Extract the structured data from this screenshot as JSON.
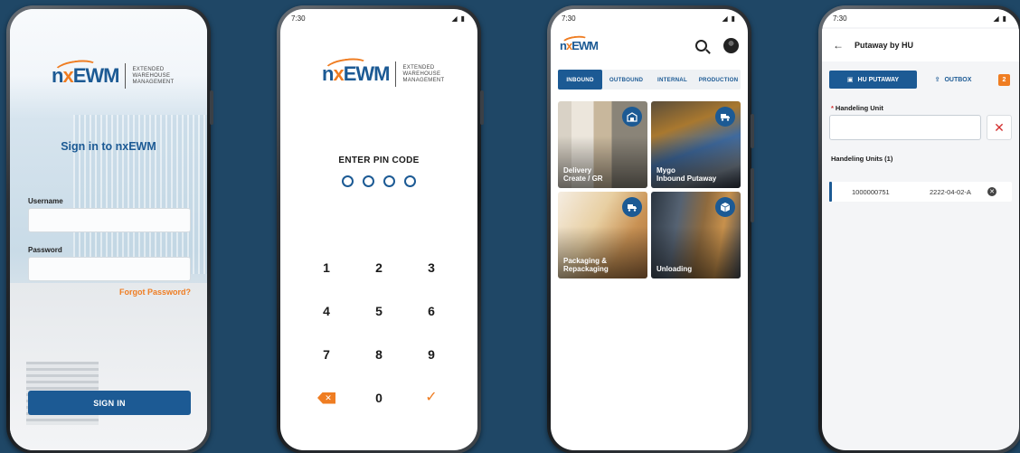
{
  "colors": {
    "background": "#1f4766",
    "primary": "#1c5a94",
    "accent": "#ef7d22",
    "danger": "#d32f2f"
  },
  "logo": {
    "brand": "nxEWM",
    "brand_prefix": "n",
    "brand_x": "x",
    "brand_suffix": "EWM",
    "line1": "EXTENDED",
    "line2": "WAREHOUSE",
    "line3": "MANAGEMENT"
  },
  "login": {
    "title": "Sign in to nxEWM",
    "username_label": "Username",
    "password_label": "Password",
    "forgot_label": "Forgot Password?",
    "signin_label": "SIGN IN"
  },
  "pin": {
    "time": "7:30",
    "title": "ENTER PIN CODE",
    "keys": [
      "1",
      "2",
      "3",
      "4",
      "5",
      "6",
      "7",
      "8",
      "9"
    ],
    "zero": "0",
    "delete_icon": "backspace-icon",
    "confirm_icon": "check-icon"
  },
  "home": {
    "time": "7:30",
    "tabs": [
      "INBOUND",
      "OUTBOUND",
      "INTERNAL",
      "PRODUCTION"
    ],
    "tiles": [
      {
        "label": "Delivery\nCreate / GR",
        "icon": "warehouse-icon"
      },
      {
        "label": "Mygo\nInbound Putaway",
        "icon": "truck-icon"
      },
      {
        "label": "Packaging &\nRepackaging",
        "icon": "delivery-truck-icon"
      },
      {
        "label": "Unloading",
        "icon": "box-icon"
      }
    ]
  },
  "putaway": {
    "time": "7:30",
    "title": "Putaway by HU",
    "hu_putaway": "HU PUTAWAY",
    "outbox": "OUTBOX",
    "outbox_count": "2",
    "required_mark": "*",
    "field_label": "Handeling Unit",
    "section_title": "Handeling Units (1)",
    "rows": [
      {
        "hu": "1000000751",
        "bin": "2222-04-02-A"
      }
    ]
  }
}
